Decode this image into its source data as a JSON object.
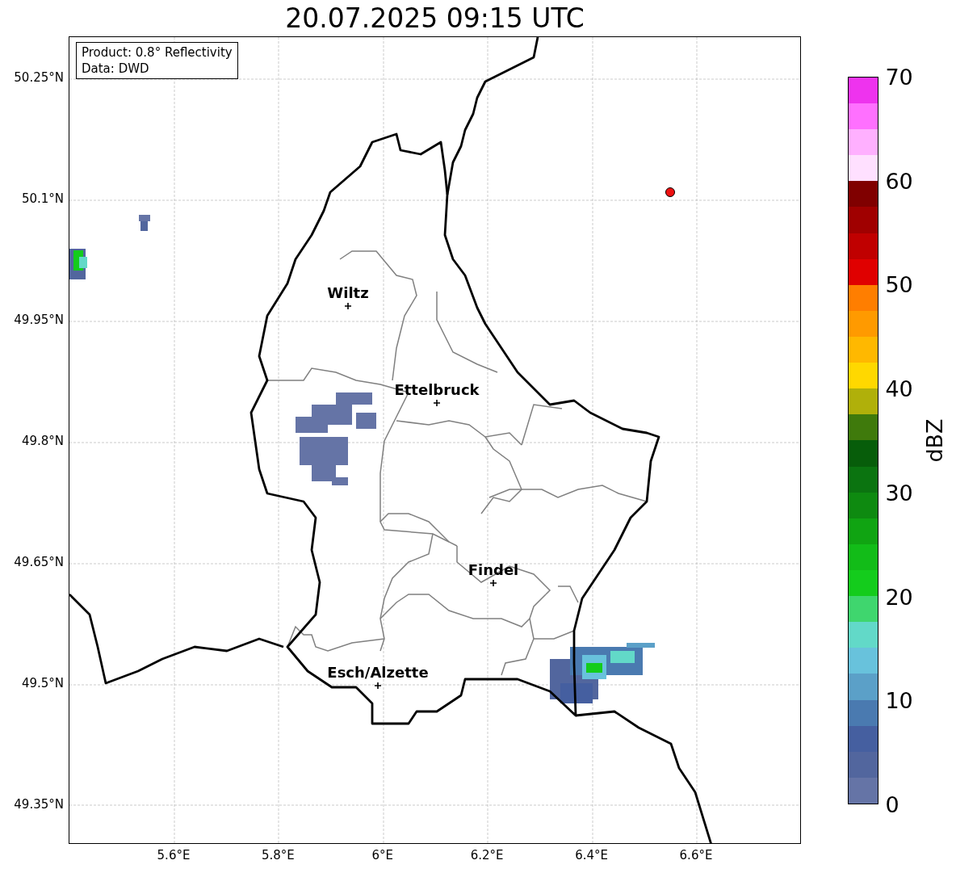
{
  "title": "20.07.2025 09:15 UTC",
  "info_box": [
    "Product: 0.8° Reflectivity",
    "Data: DWD"
  ],
  "lat_ticks": [
    "50.25°N",
    "50.1°N",
    "49.95°N",
    "49.8°N",
    "49.65°N",
    "49.5°N",
    "49.35°N"
  ],
  "lon_ticks": [
    "5.6°E",
    "5.8°E",
    "6°E",
    "6.2°E",
    "6.4°E",
    "6.6°E"
  ],
  "cities": [
    {
      "name": "Wiltz"
    },
    {
      "name": "Ettelbruck"
    },
    {
      "name": "Findel"
    },
    {
      "name": "Esch/Alzette"
    }
  ],
  "colorbar": {
    "label": "dBZ",
    "ticks": [
      "70",
      "60",
      "50",
      "40",
      "30",
      "20",
      "10",
      "0"
    ],
    "segments": [
      {
        "color": "#6574a6"
      },
      {
        "color": "#52669e"
      },
      {
        "color": "#455fa0"
      },
      {
        "color": "#4a7ab0"
      },
      {
        "color": "#5ba0c8"
      },
      {
        "color": "#68c2dc"
      },
      {
        "color": "#62d9c8"
      },
      {
        "color": "#3fd66e"
      },
      {
        "color": "#14cc1c"
      },
      {
        "color": "#12bc18"
      },
      {
        "color": "#10a412"
      },
      {
        "color": "#0e8a10"
      },
      {
        "color": "#0b7410"
      },
      {
        "color": "#075d0a"
      },
      {
        "color": "#3f7a0c"
      },
      {
        "color": "#b0b00a"
      },
      {
        "color": "#ffd800"
      },
      {
        "color": "#ffb800"
      },
      {
        "color": "#ff9a00"
      },
      {
        "color": "#ff7e00"
      },
      {
        "color": "#e00000"
      },
      {
        "color": "#c00000"
      },
      {
        "color": "#a00000"
      },
      {
        "color": "#800000"
      },
      {
        "color": "#ffe0ff"
      },
      {
        "color": "#ffb0ff"
      },
      {
        "color": "#ff70ff"
      },
      {
        "color": "#ee33ee"
      }
    ]
  }
}
